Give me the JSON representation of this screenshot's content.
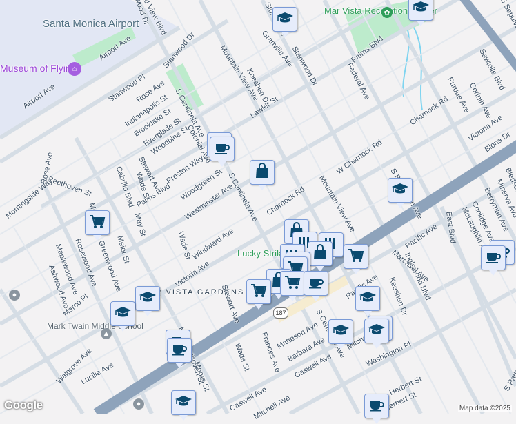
{
  "map": {
    "places": {
      "airport": "Santa Monica Airport",
      "museum": "Museum of Flying",
      "rec_center": "Mar Vista Recreation Center",
      "lucky_strike": "Lucky Strike",
      "gardens": "MAR VISTA GARDENS",
      "school": "Mark Twain Middle School"
    },
    "streets": [
      "Airport Ave",
      "Airport Ave",
      "Stanwood Dr",
      "Mountain View Ave",
      "Keeshen Dr",
      "Stoner Ave",
      "Granville Ave",
      "Palms Blvd",
      "Federal Ave",
      "Sawtelle Blvd",
      "Corinth Ave",
      "Purdue Ave",
      "Charnock Rd",
      "Victoria Ave",
      "Biona Dr",
      "S Sepulveda Blvd",
      "Lawler St",
      "Stanwood Pl",
      "Rose Ave",
      "Indianapolis St",
      "Brooklake St",
      "Everglade St",
      "Woodbine St",
      "S Centinela Ave",
      "Colonial Ave",
      "Stewart Ave",
      "Preston Way",
      "Palms Blvd",
      "Wade St",
      "Cabrillo Blvd",
      "Woodgreen St",
      "Westminster Ave",
      "S Centinela Ave",
      "Charnock Rd",
      "W Charnock Rd",
      "Mountain View Ave",
      "S Barrington Ave",
      "Rose Ave",
      "Beethoven St",
      "Morningside Way",
      "Moore St",
      "May St",
      "Meier St",
      "Wade St",
      "Windward Ave",
      "Victoria Ave",
      "Stewart Ave",
      "Maplewood Ave",
      "Rosewood Ave",
      "Greenwood Ave",
      "Ashwood Ave",
      "Marco Pl",
      "Walgrove Ave",
      "Lucille Ave",
      "May St",
      "Moore St",
      "Wade St",
      "Frances Ave",
      "Matteson Ave",
      "Barbara Ave",
      "Caswell Ave",
      "Mitchell Ave",
      "Washington Pl",
      "Herbert St",
      "Herbert St",
      "Keeshen Dr",
      "Inglewood Blvd",
      "Pacific Ave",
      "Pacific Ave",
      "Marcasel Ave",
      "East Blvd",
      "McLaughlin Ave",
      "Coolidge Ave",
      "Berryman Ave",
      "Minerva Ave",
      "Bledsoe St",
      "S Park Dr",
      "Caswell Ave",
      "Mitchell Ave",
      "Beethoven St",
      "S Centinela Ave",
      "Stanwood Dr",
      "Stanwood Dr",
      "Grand View Blvd"
    ],
    "route_shield": "187",
    "credit": "Map data ©2025",
    "logo": "Google",
    "colors": {
      "highway": "#8ea3bb",
      "park": "#bdebcc",
      "airport": "#e2e7f4",
      "pin_bg": "#e6ecfb",
      "pin_icon": "#0b4a6f"
    }
  }
}
